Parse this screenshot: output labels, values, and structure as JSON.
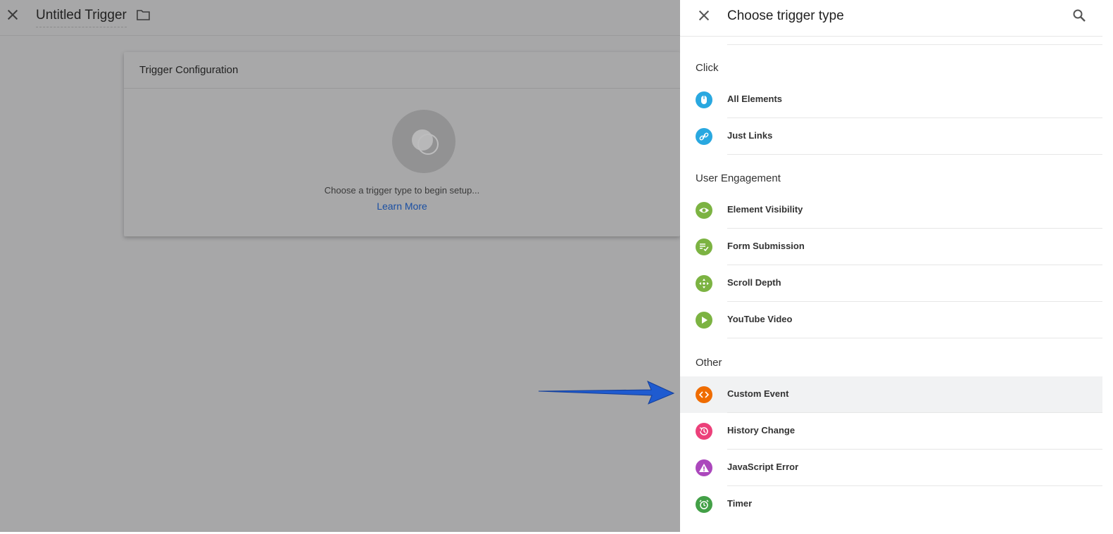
{
  "editor": {
    "title": "Untitled Trigger",
    "card_title": "Trigger Configuration",
    "hint": "Choose a trigger type to begin setup...",
    "learn_more": "Learn More"
  },
  "panel": {
    "title": "Choose trigger type",
    "sections": [
      {
        "name": "Click",
        "items": [
          {
            "label": "All Elements",
            "icon": "mouse-icon",
            "color": "#29a8e0"
          },
          {
            "label": "Just Links",
            "icon": "link-icon",
            "color": "#29a8e0"
          }
        ]
      },
      {
        "name": "User Engagement",
        "items": [
          {
            "label": "Element Visibility",
            "icon": "eye-icon",
            "color": "#7cb342"
          },
          {
            "label": "Form Submission",
            "icon": "form-check-icon",
            "color": "#7cb342"
          },
          {
            "label": "Scroll Depth",
            "icon": "scroll-arrows-icon",
            "color": "#7cb342"
          },
          {
            "label": "YouTube Video",
            "icon": "play-icon",
            "color": "#7cb342"
          }
        ]
      },
      {
        "name": "Other",
        "items": [
          {
            "label": "Custom Event",
            "icon": "code-icon",
            "color": "#ef6c00"
          },
          {
            "label": "History Change",
            "icon": "history-icon",
            "color": "#ec407a"
          },
          {
            "label": "JavaScript Error",
            "icon": "warning-icon",
            "color": "#ab47bc"
          },
          {
            "label": "Timer",
            "icon": "alarm-clock-icon",
            "color": "#43a047"
          }
        ]
      }
    ]
  }
}
